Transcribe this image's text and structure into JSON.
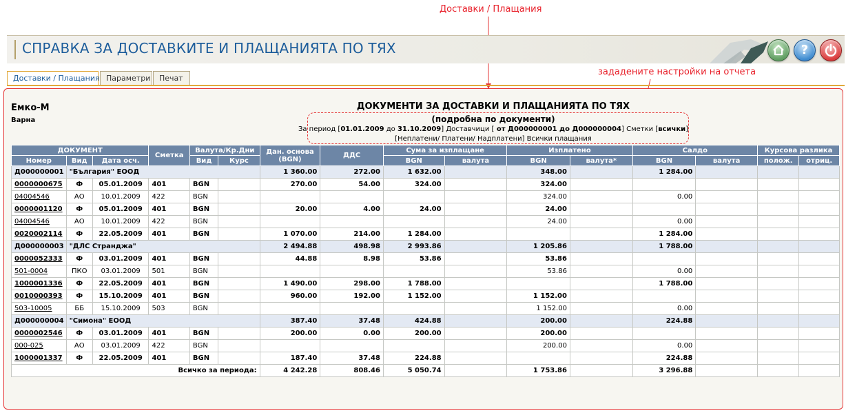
{
  "annotations": {
    "top": "Доставки / Плащания",
    "settings": "зададените настройки на отчета"
  },
  "header": {
    "title": "СПРАВКА ЗА ДОСТАВКИТЕ И ПЛАЩАНИЯТА ПО ТЯХ",
    "buttons": [
      "home-icon",
      "help-icon",
      "power-icon"
    ]
  },
  "tabs": [
    "Доставки / Плащания",
    "Параметри",
    "Печат"
  ],
  "company": {
    "name": "Емко-М",
    "city": "Варна"
  },
  "report": {
    "title": "ДОКУМЕНТИ ЗА ДОСТАВКИ И ПЛАЩАНИЯТА ПО ТЯХ",
    "subtitle": "(подробна по документи)",
    "period_label": "За период [",
    "period_from": "01.01.2009",
    "period_to_word": " до ",
    "period_to": "31.10.2009",
    "suppliers_label": "] Доставчици [",
    "suppliers_value": " от Д000000001 до Д000000004",
    "accounts_label": "] Сметки [",
    "accounts_value": "всички",
    "close_bracket": "]",
    "payments_filter": "[Неплатени/ Платени/ Надплатени] Всички плащания"
  },
  "columns": {
    "group_document": "ДОКУМЕНТ",
    "account": "Сметка",
    "group_currency": "Валута/Кр.Дни",
    "tax_base": "Дан. основа (BGN)",
    "vat": "ДДС",
    "group_to_pay": "Сума за изплащане",
    "group_paid": "Изплатено",
    "group_balance": "Салдо",
    "group_fx": "Курсова разлика",
    "number": "Номер",
    "type": "Вид",
    "date": "Дата осч.",
    "cur_type": "Вид",
    "rate": "Курс",
    "bgn": "BGN",
    "currency": "валута",
    "currency_star": "валута*",
    "pos": "полож.",
    "neg": "отриц."
  },
  "rows": [
    {
      "kind": "supplier",
      "num": "Д000000001",
      "name": "\"България\" ЕООД",
      "base": "1 360.00",
      "vat": "272.00",
      "pay_bgn": "1 632.00",
      "paid_bgn": "348.00",
      "bal_bgn": "1 284.00"
    },
    {
      "kind": "doc",
      "bold": true,
      "num": "0000000675",
      "type": "Ф",
      "date": "05.01.2009",
      "acc": "401",
      "cur": "BGN",
      "base": "270.00",
      "vat": "54.00",
      "pay_bgn": "324.00",
      "paid_bgn": "324.00",
      "bal_bgn": ""
    },
    {
      "kind": "doc",
      "bold": false,
      "num": "04004546",
      "type": "АО",
      "date": "10.01.2009",
      "acc": "422",
      "cur": "BGN",
      "base": "",
      "vat": "",
      "pay_bgn": "",
      "paid_bgn": "324.00",
      "bal_bgn": "0.00"
    },
    {
      "kind": "doc",
      "bold": true,
      "num": "0000001120",
      "type": "Ф",
      "date": "05.01.2009",
      "acc": "401",
      "cur": "BGN",
      "base": "20.00",
      "vat": "4.00",
      "pay_bgn": "24.00",
      "paid_bgn": "24.00",
      "bal_bgn": ""
    },
    {
      "kind": "doc",
      "bold": false,
      "num": "04004546",
      "type": "АО",
      "date": "10.01.2009",
      "acc": "422",
      "cur": "BGN",
      "base": "",
      "vat": "",
      "pay_bgn": "",
      "paid_bgn": "24.00",
      "bal_bgn": "0.00"
    },
    {
      "kind": "doc",
      "bold": true,
      "num": "0020002114",
      "type": "Ф",
      "date": "22.05.2009",
      "acc": "401",
      "cur": "BGN",
      "base": "1 070.00",
      "vat": "214.00",
      "pay_bgn": "1 284.00",
      "paid_bgn": "",
      "bal_bgn": "1 284.00"
    },
    {
      "kind": "supplier",
      "num": "Д000000003",
      "name": "\"ДЛС Странджа\"",
      "base": "2 494.88",
      "vat": "498.98",
      "pay_bgn": "2 993.86",
      "paid_bgn": "1 205.86",
      "bal_bgn": "1 788.00"
    },
    {
      "kind": "doc",
      "bold": true,
      "num": "0000052333",
      "type": "Ф",
      "date": "03.01.2009",
      "acc": "401",
      "cur": "BGN",
      "base": "44.88",
      "vat": "8.98",
      "pay_bgn": "53.86",
      "paid_bgn": "53.86",
      "bal_bgn": ""
    },
    {
      "kind": "doc",
      "bold": false,
      "num": "501-0004",
      "type": "ПКО",
      "date": "03.01.2009",
      "acc": "501",
      "cur": "BGN",
      "base": "",
      "vat": "",
      "pay_bgn": "",
      "paid_bgn": "53.86",
      "bal_bgn": "0.00"
    },
    {
      "kind": "doc",
      "bold": true,
      "num": "1000001336",
      "type": "Ф",
      "date": "22.05.2009",
      "acc": "401",
      "cur": "BGN",
      "base": "1 490.00",
      "vat": "298.00",
      "pay_bgn": "1 788.00",
      "paid_bgn": "",
      "bal_bgn": "1 788.00"
    },
    {
      "kind": "doc",
      "bold": true,
      "num": "0010000393",
      "type": "Ф",
      "date": "15.10.2009",
      "acc": "401",
      "cur": "BGN",
      "base": "960.00",
      "vat": "192.00",
      "pay_bgn": "1 152.00",
      "paid_bgn": "1 152.00",
      "bal_bgn": ""
    },
    {
      "kind": "doc",
      "bold": false,
      "num": "503-10005",
      "type": "ББ",
      "date": "15.10.2009",
      "acc": "503",
      "cur": "BGN",
      "base": "",
      "vat": "",
      "pay_bgn": "",
      "paid_bgn": "1 152.00",
      "bal_bgn": "0.00"
    },
    {
      "kind": "supplier",
      "num": "Д000000004",
      "name": "\"Симона\" ЕООД",
      "base": "387.40",
      "vat": "37.48",
      "pay_bgn": "424.88",
      "paid_bgn": "200.00",
      "bal_bgn": "224.88"
    },
    {
      "kind": "doc",
      "bold": true,
      "num": "0000002546",
      "type": "Ф",
      "date": "03.01.2009",
      "acc": "401",
      "cur": "BGN",
      "base": "200.00",
      "vat": "0.00",
      "pay_bgn": "200.00",
      "paid_bgn": "200.00",
      "bal_bgn": ""
    },
    {
      "kind": "doc",
      "bold": false,
      "num": "000-025",
      "type": "АО",
      "date": "03.01.2009",
      "acc": "422",
      "cur": "BGN",
      "base": "",
      "vat": "",
      "pay_bgn": "",
      "paid_bgn": "200.00",
      "bal_bgn": "0.00"
    },
    {
      "kind": "doc",
      "bold": true,
      "num": "1000001337",
      "type": "Ф",
      "date": "22.05.2009",
      "acc": "401",
      "cur": "BGN",
      "base": "187.40",
      "vat": "37.48",
      "pay_bgn": "224.88",
      "paid_bgn": "",
      "bal_bgn": "224.88"
    }
  ],
  "totals": {
    "label": "Всичко за периода:",
    "base": "4 242.28",
    "vat": "808.46",
    "pay_bgn": "5 050.74",
    "paid_bgn": "1 753.86",
    "bal_bgn": "3 296.88"
  }
}
